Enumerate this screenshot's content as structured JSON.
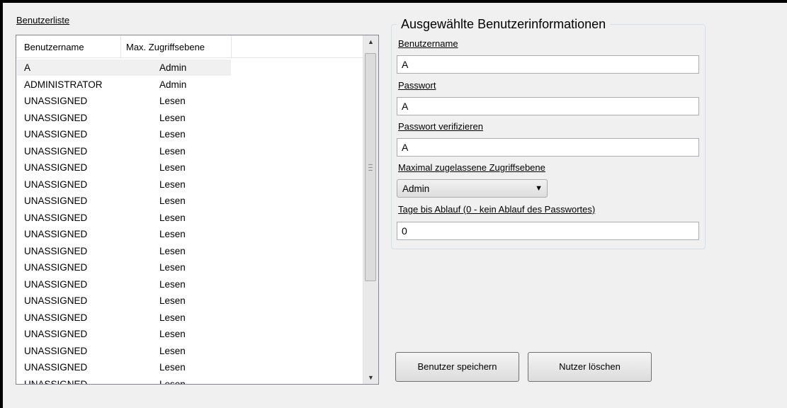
{
  "user_list": {
    "label": "Benutzerliste",
    "columns": [
      "Benutzername",
      "Max. Zugriffsebene"
    ],
    "rows": [
      {
        "name": "A",
        "level": "Admin"
      },
      {
        "name": "ADMINISTRATOR",
        "level": "Admin"
      },
      {
        "name": "UNASSIGNED",
        "level": "Lesen"
      },
      {
        "name": "UNASSIGNED",
        "level": "Lesen"
      },
      {
        "name": "UNASSIGNED",
        "level": "Lesen"
      },
      {
        "name": "UNASSIGNED",
        "level": "Lesen"
      },
      {
        "name": "UNASSIGNED",
        "level": "Lesen"
      },
      {
        "name": "UNASSIGNED",
        "level": "Lesen"
      },
      {
        "name": "UNASSIGNED",
        "level": "Lesen"
      },
      {
        "name": "UNASSIGNED",
        "level": "Lesen"
      },
      {
        "name": "UNASSIGNED",
        "level": "Lesen"
      },
      {
        "name": "UNASSIGNED",
        "level": "Lesen"
      },
      {
        "name": "UNASSIGNED",
        "level": "Lesen"
      },
      {
        "name": "UNASSIGNED",
        "level": "Lesen"
      },
      {
        "name": "UNASSIGNED",
        "level": "Lesen"
      },
      {
        "name": "UNASSIGNED",
        "level": "Lesen"
      },
      {
        "name": "UNASSIGNED",
        "level": "Lesen"
      },
      {
        "name": "UNASSIGNED",
        "level": "Lesen"
      },
      {
        "name": "UNASSIGNED",
        "level": "Lesen"
      },
      {
        "name": "UNASSIGNED",
        "level": "Lesen"
      }
    ],
    "selected_index": 0
  },
  "details": {
    "title": "Ausgewählte Benutzerinformationen",
    "username_label": "Benutzername",
    "username_value": "A",
    "password_label": "Passwort",
    "password_value": "A",
    "verify_label": "Passwort verifizieren",
    "verify_value": "A",
    "access_label": "Maximal zugelassene Zugriffsebene",
    "access_value": "Admin",
    "expiry_label": "Tage bis Ablauf (0 - kein Ablauf des Passwortes)",
    "expiry_value": "0"
  },
  "buttons": {
    "save": "Benutzer speichern",
    "delete": "Nutzer löschen"
  },
  "icons": {
    "scroll_up": "scroll-up-arrow-icon",
    "scroll_down": "scroll-down-arrow-icon",
    "dropdown": "chevron-down-icon"
  }
}
